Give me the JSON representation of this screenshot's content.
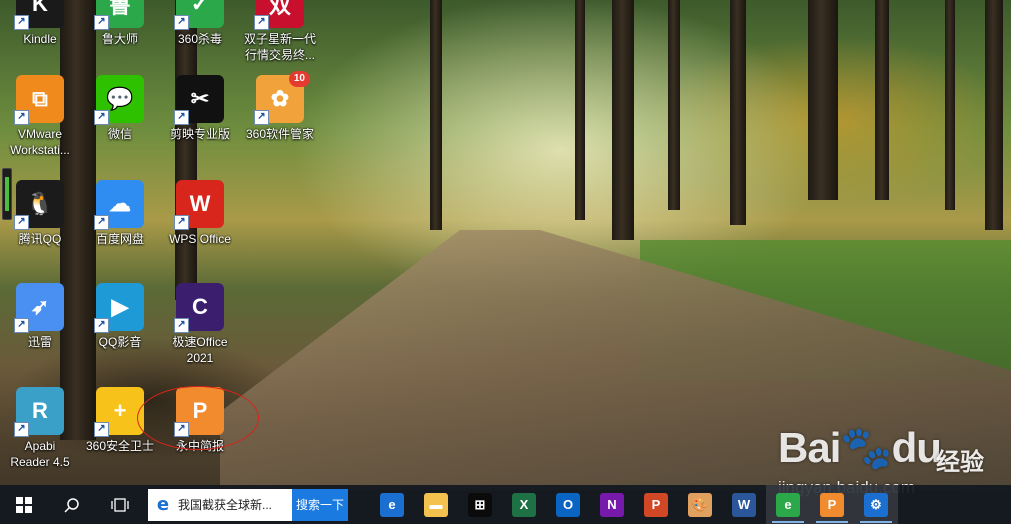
{
  "desktop": {
    "icons": [
      {
        "label": "Kindle",
        "icon": "kindle-icon",
        "color": "#1a1a1a",
        "glyph": "K"
      },
      {
        "label": "鲁大师",
        "icon": "ludashi-icon",
        "color": "#2aa84a",
        "glyph": "鲁"
      },
      {
        "label": "360杀毒",
        "icon": "360-antivirus-icon",
        "color": "#2aa84a",
        "glyph": "✓"
      },
      {
        "label": "双子星新一代\n行情交易终...",
        "icon": "gemini-trading-icon",
        "color": "#c8102e",
        "glyph": "双"
      },
      {
        "label": "VMware\nWorkstati...",
        "icon": "vmware-icon",
        "color": "#f08a1c",
        "glyph": "⧉"
      },
      {
        "label": "微信",
        "icon": "wechat-icon",
        "color": "#2dc100",
        "glyph": "💬"
      },
      {
        "label": "剪映专业版",
        "icon": "jianying-icon",
        "color": "#111111",
        "glyph": "✂"
      },
      {
        "label": "360软件管家",
        "icon": "360-software-manager-icon",
        "color": "#f2a23a",
        "glyph": "✿",
        "badge": "10"
      },
      {
        "label": "腾讯QQ",
        "icon": "qq-penguin-icon",
        "color": "#1b1b1b",
        "glyph": "🐧"
      },
      {
        "label": "百度网盘",
        "icon": "baidu-netdisk-icon",
        "color": "#2f8cf0",
        "glyph": "☁"
      },
      {
        "label": "WPS Office",
        "icon": "wps-office-icon",
        "color": "#d9261c",
        "glyph": "W"
      },
      {
        "label": "迅雷",
        "icon": "xunlei-thunder-icon",
        "color": "#4a90f2",
        "glyph": "➶"
      },
      {
        "label": "QQ影音",
        "icon": "qq-player-icon",
        "color": "#1e9bd7",
        "glyph": "▶"
      },
      {
        "label": "极速Office\n2021",
        "icon": "jisu-office-icon",
        "color": "#3b1f6e",
        "glyph": "C"
      },
      {
        "label": "Apabi\nReader 4.5",
        "icon": "apabi-reader-icon",
        "color": "#3aa0c8",
        "glyph": "R"
      },
      {
        "label": "360安全卫士",
        "icon": "360-security-guard-icon",
        "color": "#f7c21a",
        "glyph": "+"
      },
      {
        "label": "永中简报",
        "icon": "yozo-presentation-icon",
        "color": "#f28a2e",
        "glyph": "P"
      }
    ]
  },
  "watermark": {
    "logo": "Bai🐾du",
    "text": "经验",
    "url": "jingyan.baidu.com"
  },
  "taskbar": {
    "search_query": "我国截获全球新...",
    "search_button": "搜索一下",
    "apps": [
      {
        "name": "edge",
        "icon": "edge-icon",
        "color": "#1a6fd1",
        "glyph": "e",
        "open": false
      },
      {
        "name": "file-explorer",
        "icon": "folder-icon",
        "color": "#f2c14e",
        "glyph": "▬",
        "open": false
      },
      {
        "name": "store",
        "icon": "store-icon",
        "color": "#0b0b0b",
        "glyph": "⊞",
        "open": false
      },
      {
        "name": "excel",
        "icon": "excel-icon",
        "color": "#1e7145",
        "glyph": "X",
        "open": false
      },
      {
        "name": "outlook",
        "icon": "outlook-icon",
        "color": "#0a64c2",
        "glyph": "O",
        "open": false
      },
      {
        "name": "onenote",
        "icon": "onenote-icon",
        "color": "#7719aa",
        "glyph": "N",
        "open": false
      },
      {
        "name": "powerpoint",
        "icon": "powerpoint-icon",
        "color": "#d24726",
        "glyph": "P",
        "open": false
      },
      {
        "name": "paint",
        "icon": "paint-palette-icon",
        "color": "#e0a060",
        "glyph": "🎨",
        "open": false
      },
      {
        "name": "word",
        "icon": "word-icon",
        "color": "#2b579a",
        "glyph": "W",
        "open": false
      },
      {
        "name": "360-browser",
        "icon": "360-browser-icon",
        "color": "#2aa84a",
        "glyph": "e",
        "open": true
      },
      {
        "name": "yozo-presentation",
        "icon": "yozo-presentation-icon",
        "color": "#f28a2e",
        "glyph": "P",
        "open": true
      },
      {
        "name": "settings",
        "icon": "gear-icon",
        "color": "#1a6fd1",
        "glyph": "⚙",
        "open": true
      }
    ]
  }
}
